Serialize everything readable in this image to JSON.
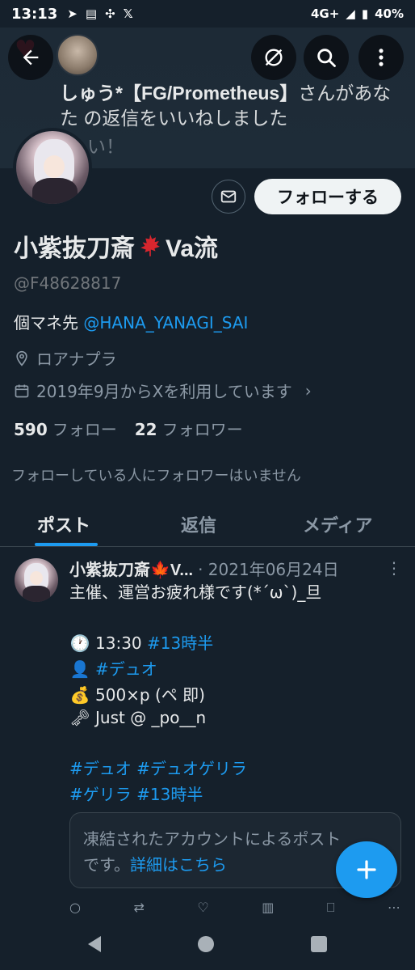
{
  "status_bar": {
    "time": "13:13",
    "icons": [
      "navigation-icon",
      "news-icon",
      "app-icon",
      "x-logo-icon"
    ],
    "network": "4G+",
    "battery": "40%"
  },
  "notification": {
    "name": "しゅう*【FG/Prometheus】",
    "text_rest": "さんがあな",
    "line2": "た の返信をいいねしました",
    "faded": "い！"
  },
  "profile": {
    "display_name": "小紫抜刀斎",
    "name_suffix": "Va流",
    "handle": "@F48628817",
    "bio_prefix": "個マネ先 ",
    "bio_link": "@HANA_YANAGI_SAI",
    "location": "ロアナプラ",
    "joined": "2019年9月からXを利用しています",
    "following_count": "590",
    "following_label": "フォロー",
    "followers_count": "22",
    "followers_label": "フォロワー",
    "followers_note": "フォローしている人にフォロワーはいません",
    "follow_label": "フォローする"
  },
  "tabs": [
    {
      "label": "ポスト"
    },
    {
      "label": "返信"
    },
    {
      "label": "メディア"
    }
  ],
  "post": {
    "author": "小紫抜刀斎🍁V...",
    "date": "· 2021年06月24日",
    "line1": "主催、運営お疲れ様です(*´ω`)_旦",
    "time_text": "13:30 ",
    "time_tag": "#13時半",
    "person_tag": "#デュオ",
    "money_text": "500×p (ペ 即)",
    "key_text": "Just @ _po__n",
    "tags_line1": "#デュオ #デュオゲリラ",
    "tags_line2": "#ゲリラ #13時半",
    "quote_line1": "凍結されたアカウントによるポスト",
    "quote_prefix": "です。",
    "quote_link": "詳細はこちら"
  },
  "colors": {
    "background": "#15202b",
    "accent": "#1d9bf0",
    "text_primary": "#e7e9ea",
    "text_secondary": "#8b98a5"
  }
}
